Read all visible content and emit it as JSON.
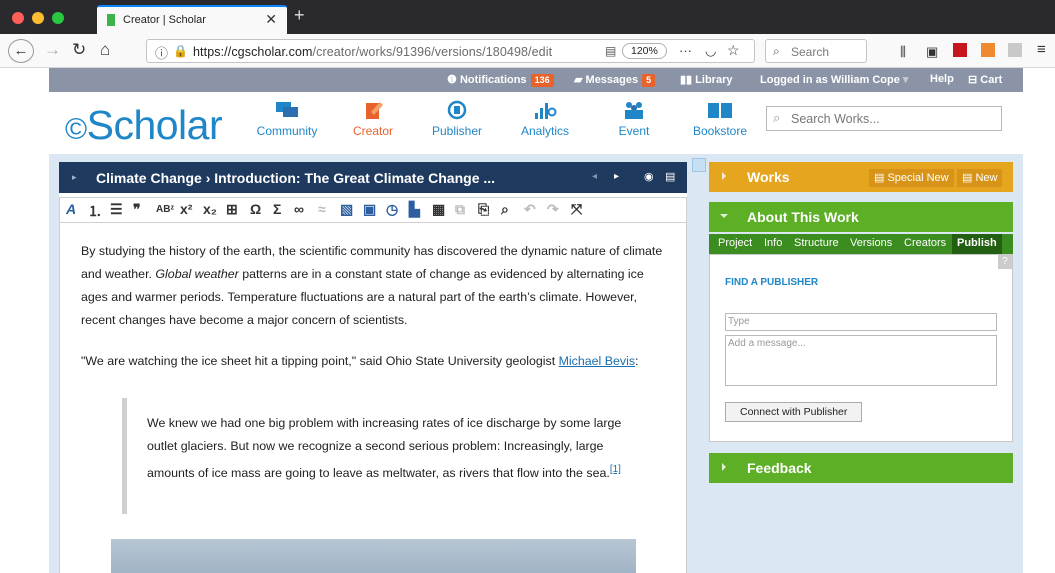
{
  "browser": {
    "tab_title": "Creator | Scholar",
    "url_host": "https://cgscholar.com",
    "url_path": "/creator/works/91396/versions/180498/edit",
    "zoom": "120%",
    "search_placeholder": "Search",
    "more_label": "···"
  },
  "topbar": {
    "notifications_label": "Notifications",
    "notifications_count": "136",
    "messages_label": "Messages",
    "messages_count": "5",
    "library_label": "Library",
    "logged_in": "Logged in as William Cope",
    "help_label": "Help",
    "cart_label": "Cart"
  },
  "header": {
    "logo": "Scholar",
    "nav": [
      {
        "label": "Community"
      },
      {
        "label": "Creator"
      },
      {
        "label": "Publisher"
      },
      {
        "label": "Analytics"
      },
      {
        "label": "Event"
      },
      {
        "label": "Bookstore"
      }
    ],
    "search_placeholder": "Search Works..."
  },
  "editor": {
    "title": "Climate Change › Introduction: The Great Climate Change ...",
    "p1_a": "By studying the history of the earth, the scientific community has discovered the dynamic nature of climate and weather. ",
    "p1_em": "Global weather",
    "p1_b": " patterns are in a constant state of change as evidenced by alternating ice ages and warmer periods. Temperature fluctuations are a natural part of the earth’s climate. However, recent changes have become a major concern of scientists.",
    "p2_a": "\"We are watching the ice sheet hit a tipping point,\" said Ohio State University geologist ",
    "p2_link": "Michael Bevis",
    "p2_b": ":",
    "quote": "We knew we had one big problem with increasing rates of ice discharge by some large outlet glaciers. But now we recognize a second serious problem: Increasingly, large amounts of ice mass are going to leave as meltwater, as rivers that flow into the sea.",
    "footnote": "[1]"
  },
  "sidebar": {
    "works_label": "Works",
    "special_new_label": "Special New",
    "new_label": "New",
    "about_label": "About This Work",
    "tabs": [
      "Project",
      "Info",
      "Structure",
      "Versions",
      "Creators",
      "Publish"
    ],
    "help_q": "?",
    "find_publisher": "FIND A PUBLISHER",
    "type_placeholder": "Type",
    "message_placeholder": "Add a message...",
    "connect_label": "Connect with Publisher",
    "feedback_label": "Feedback"
  },
  "colors": {
    "accent_blue": "#1f86c8",
    "works_yellow": "#e6a51e",
    "about_green": "#5db025",
    "title_navy": "#1e3a5f",
    "creator_orange": "#e8632b"
  }
}
